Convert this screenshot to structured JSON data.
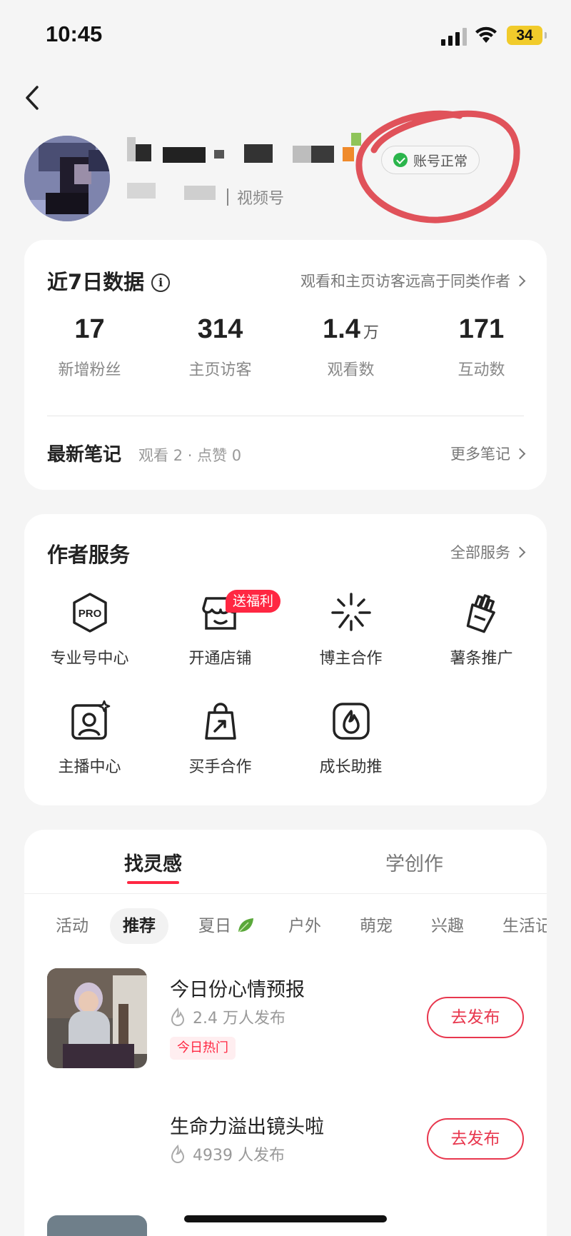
{
  "status_bar": {
    "time": "10:45",
    "battery": "34"
  },
  "profile": {
    "account_status": "账号正常",
    "channel_label": "视频号"
  },
  "data_card": {
    "title": "近7日数据",
    "insight_link": "观看和主页访客远高于同类作者",
    "stats": [
      {
        "value": "17",
        "unit": "",
        "label": "新增粉丝"
      },
      {
        "value": "314",
        "unit": "",
        "label": "主页访客"
      },
      {
        "value": "1.4",
        "unit": "万",
        "label": "观看数"
      },
      {
        "value": "171",
        "unit": "",
        "label": "互动数"
      }
    ],
    "latest_title": "最新笔记",
    "latest_meta": "观看 2 · 点赞 0",
    "more_link": "更多笔记"
  },
  "services": {
    "title": "作者服务",
    "all_link": "全部服务",
    "badge": "送福利",
    "items": [
      {
        "label": "专业号中心",
        "icon": "pro-icon"
      },
      {
        "label": "开通店铺",
        "icon": "store-icon"
      },
      {
        "label": "博主合作",
        "icon": "sparkle-icon"
      },
      {
        "label": "薯条推广",
        "icon": "fries-icon"
      },
      {
        "label": "主播中心",
        "icon": "streamer-icon"
      },
      {
        "label": "买手合作",
        "icon": "shopping-bag-icon"
      },
      {
        "label": "成长助推",
        "icon": "flame-icon"
      }
    ]
  },
  "inspiration": {
    "tabs": [
      "找灵感",
      "学创作"
    ],
    "chips": [
      "活动",
      "推荐",
      "夏日",
      "户外",
      "萌宠",
      "兴趣",
      "生活记"
    ],
    "items": [
      {
        "title": "今日份心情预报",
        "count": "2.4 万人发布",
        "tag": "今日热门",
        "button": "去发布"
      },
      {
        "title": "生命力溢出镜头啦",
        "count": "4939 人发布",
        "tag": "",
        "button": "去发布"
      }
    ]
  },
  "colors": {
    "accent": "#ff2742",
    "status_ok": "#2bb54c",
    "battery": "#f1cb2b"
  }
}
